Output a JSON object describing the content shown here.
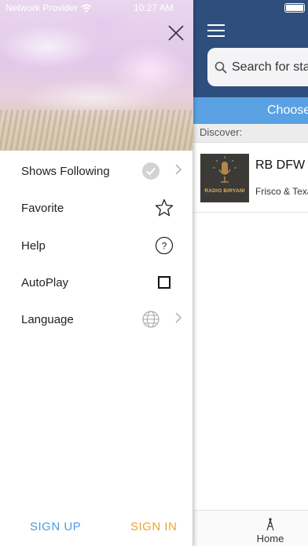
{
  "status_bar": {
    "carrier": "Network Provider",
    "time": "10:27 AM",
    "wifi_icon": "wifi-icon",
    "battery_icon": "battery-icon"
  },
  "drawer": {
    "close_icon": "close-icon",
    "menu": [
      {
        "label": "Shows Following",
        "icon": "check-circle-icon",
        "chevron": true
      },
      {
        "label": "Favorite",
        "icon": "star-icon",
        "chevron": false
      },
      {
        "label": "Help",
        "icon": "help-circle-icon",
        "chevron": false
      },
      {
        "label": "AutoPlay",
        "icon": "checkbox-icon",
        "chevron": false
      },
      {
        "label": "Language",
        "icon": "globe-icon",
        "chevron": true
      }
    ],
    "footer": {
      "sign_up": "SIGN UP",
      "sign_in": "SIGN IN"
    }
  },
  "app": {
    "header": {
      "menu_icon": "hamburger-icon"
    },
    "search": {
      "placeholder": "Search for stations"
    },
    "choose_bar": "Choose",
    "discover_label": "Discover:",
    "stations": [
      {
        "name": "RB DFW",
        "location": "Frisco & Texas",
        "logo_text": "RADIO BIRYANI"
      }
    ],
    "tabbar": {
      "home": "Home",
      "home_icon": "antenna-icon"
    }
  },
  "colors": {
    "header_bg": "#2e4f7d",
    "choose_bar": "#5aa1e3",
    "sign_up": "#4d9be4",
    "sign_in": "#f0a42c"
  }
}
